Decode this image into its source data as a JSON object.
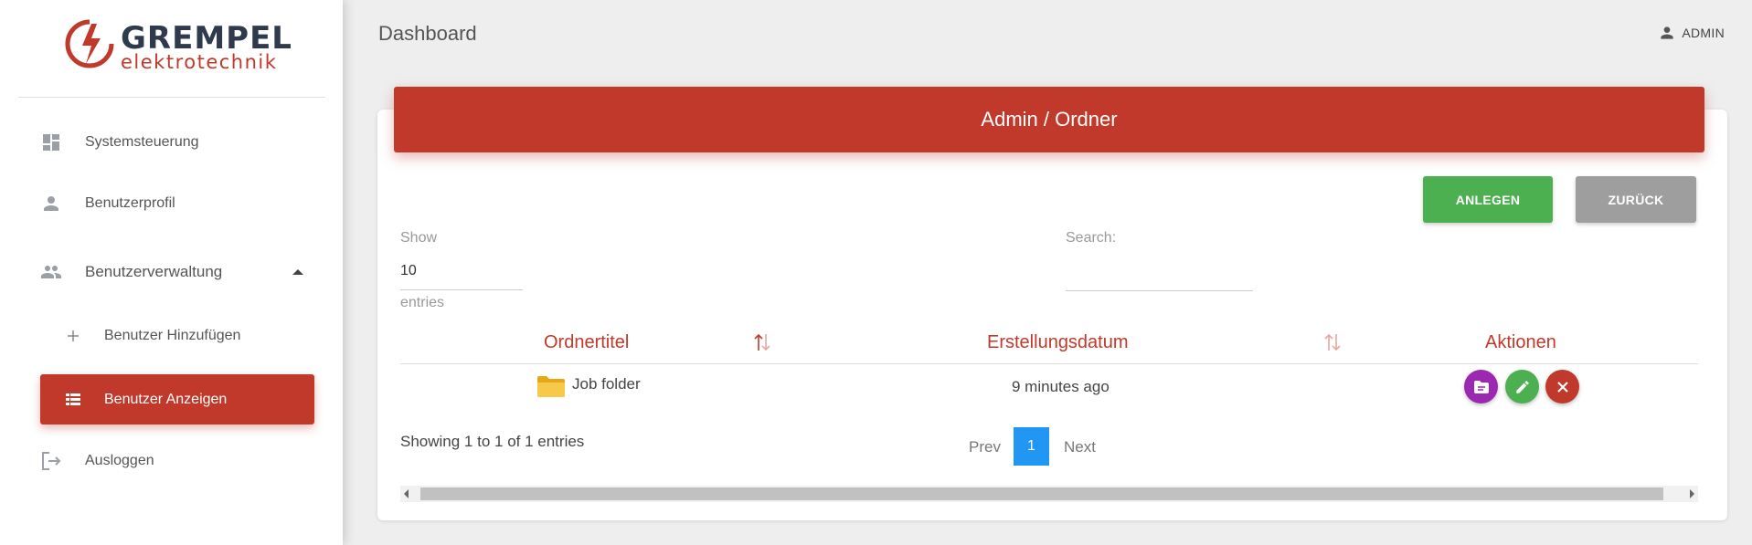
{
  "brand": {
    "name": "GREMPEL",
    "subtitle": "elektrotechnik"
  },
  "sidebar": {
    "items": [
      {
        "label": "Systemsteuerung",
        "icon": "dashboard-icon"
      },
      {
        "label": "Benutzerprofil",
        "icon": "person-icon"
      },
      {
        "label": "Benutzerverwaltung",
        "icon": "people-icon",
        "expanded": true
      },
      {
        "label": "Benutzer Hinzufügen",
        "icon": "plus-icon"
      },
      {
        "label": "Benutzer Anzeigen",
        "icon": "list-icon",
        "active": true
      },
      {
        "label": "Ausloggen",
        "icon": "logout-icon"
      }
    ]
  },
  "header": {
    "title": "Dashboard",
    "user": "ADMIN"
  },
  "card": {
    "title": "Admin / Ordner",
    "buttons": {
      "create": "ANLEGEN",
      "back": "ZURÜCK"
    },
    "length_menu": {
      "show_label": "Show",
      "value": "10",
      "entries_label": "entries"
    },
    "search": {
      "label": "Search:",
      "value": ""
    },
    "table": {
      "columns": [
        "Ordnertitel",
        "Erstellungsdatum",
        "Aktionen"
      ],
      "rows": [
        {
          "title": "Job folder",
          "created": "9 minutes ago"
        }
      ]
    },
    "info": "Showing 1 to 1 of 1 entries",
    "pagination": {
      "prev": "Prev",
      "current": "1",
      "next": "Next"
    }
  },
  "colors": {
    "primary": "#c0392b",
    "success": "#4caf50",
    "neutral": "#9e9e9e",
    "purple": "#9c27b0",
    "page_active": "#2196f3"
  }
}
